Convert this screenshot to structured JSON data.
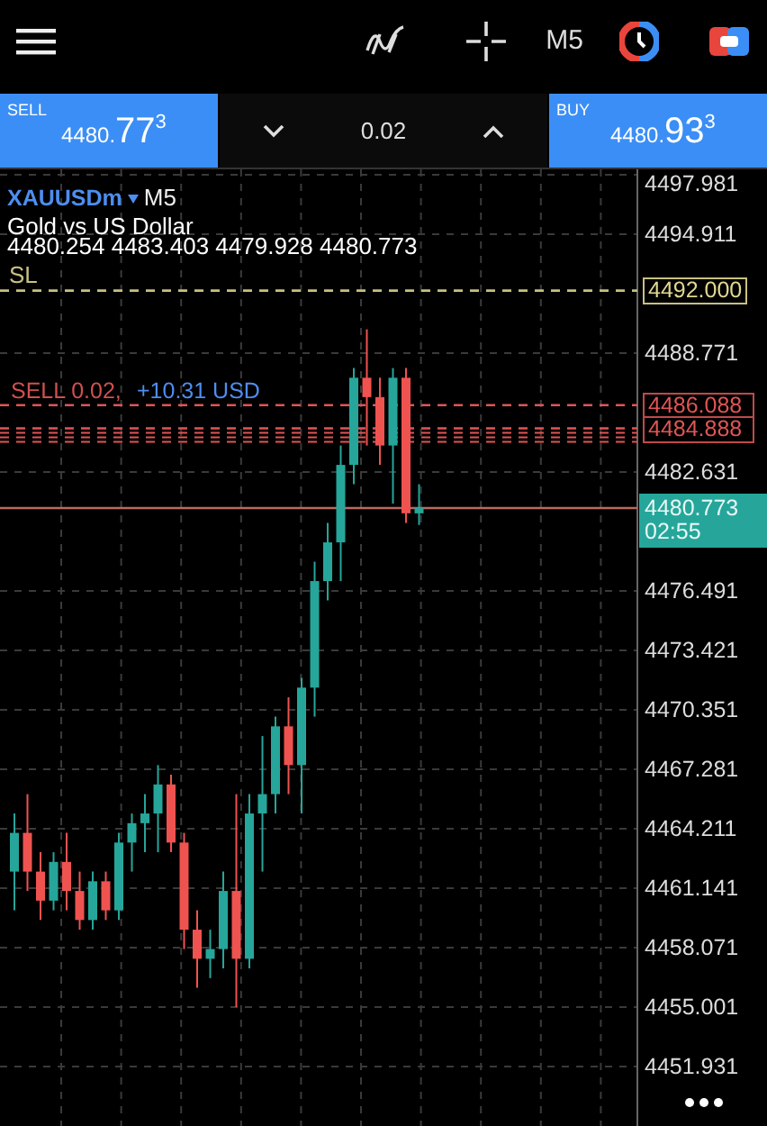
{
  "toolbar": {
    "timeframe": "M5"
  },
  "trade_panel": {
    "sell": {
      "label": "SELL",
      "price_small": "4480.",
      "price_big": "77",
      "price_sup": "3"
    },
    "volume": "0.02",
    "buy": {
      "label": "BUY",
      "price_small": "4480.",
      "price_big": "93",
      "price_sup": "3"
    }
  },
  "chart": {
    "symbol": "XAUUSDm",
    "period": "M5",
    "description": "Gold vs US Dollar",
    "ohlc": "4480.254 4483.403 4479.928 4480.773",
    "sl_label": "SL",
    "position_label": "SELL 0.02,",
    "position_profit": "+10.31 USD",
    "price_axis": [
      "4497.981",
      "4494.911",
      "4488.771",
      "4482.631",
      "4476.491",
      "4473.421",
      "4470.351",
      "4467.281",
      "4464.211",
      "4461.141",
      "4458.071",
      "4455.001",
      "4451.931"
    ],
    "sl_price": "4492.000",
    "order_prices": [
      "4486.088",
      "4484.888"
    ],
    "current_price": "4480.773",
    "bar_timer": "02:55"
  }
}
